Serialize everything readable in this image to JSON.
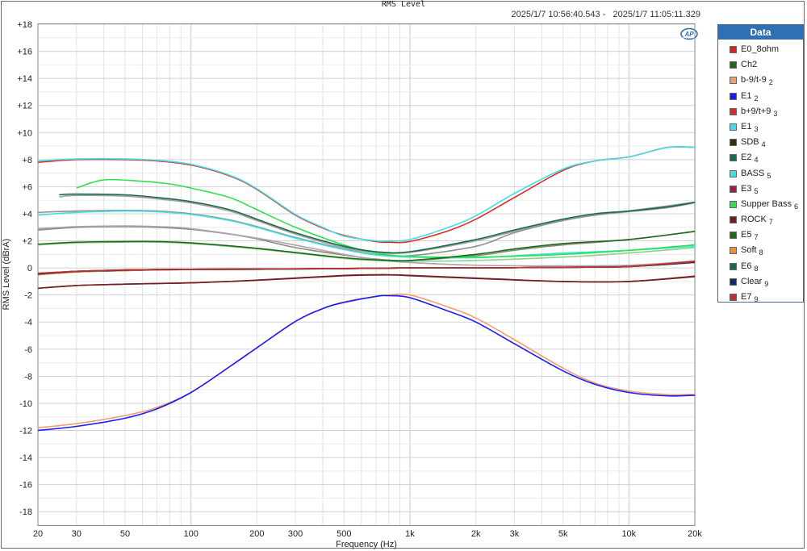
{
  "chart_data": {
    "type": "line",
    "title": "RMS Level",
    "timestamp": "2025/1/7 10:56:40.543 -   2025/1/7 11:05:11.329",
    "xlabel": "Frequency (Hz)",
    "ylabel": "RMS Level (dBrA)",
    "xscale": "log",
    "xlim": [
      20,
      20000
    ],
    "ylim": [
      -19,
      18
    ],
    "grid": true,
    "legend_position": "right",
    "legend_title": "Data",
    "x_ticks": [
      {
        "v": 20,
        "label": "20"
      },
      {
        "v": 30,
        "label": "30"
      },
      {
        "v": 50,
        "label": "50"
      },
      {
        "v": 100,
        "label": "100"
      },
      {
        "v": 200,
        "label": "200"
      },
      {
        "v": 300,
        "label": "300"
      },
      {
        "v": 500,
        "label": "500"
      },
      {
        "v": 1000,
        "label": "1k"
      },
      {
        "v": 2000,
        "label": "2k"
      },
      {
        "v": 3000,
        "label": "3k"
      },
      {
        "v": 5000,
        "label": "5k"
      },
      {
        "v": 10000,
        "label": "10k"
      },
      {
        "v": 20000,
        "label": "20k"
      }
    ],
    "y_ticks": [
      {
        "v": 18,
        "label": "+18"
      },
      {
        "v": 16,
        "label": "+16"
      },
      {
        "v": 14,
        "label": "+14"
      },
      {
        "v": 12,
        "label": "+12"
      },
      {
        "v": 10,
        "label": "+10"
      },
      {
        "v": 8,
        "label": "+8"
      },
      {
        "v": 6,
        "label": "+6"
      },
      {
        "v": 4,
        "label": "+4"
      },
      {
        "v": 2,
        "label": "+2"
      },
      {
        "v": 0,
        "label": "0"
      },
      {
        "v": -2,
        "label": "-2"
      },
      {
        "v": -4,
        "label": "-4"
      },
      {
        "v": -6,
        "label": "-6"
      },
      {
        "v": -8,
        "label": "-8"
      },
      {
        "v": -10,
        "label": "-10"
      },
      {
        "v": -12,
        "label": "-12"
      },
      {
        "v": -14,
        "label": "-14"
      },
      {
        "v": -16,
        "label": "-16"
      },
      {
        "v": -18,
        "label": "-18"
      }
    ],
    "series": [
      {
        "name": "E0_8ohm",
        "sub": "",
        "color": "#e02020",
        "x": [
          20,
          30,
          50,
          70,
          100,
          200,
          500,
          1000,
          2000,
          5000,
          10000,
          20000
        ],
        "y": [
          -0.4,
          -0.25,
          -0.15,
          -0.12,
          -0.1,
          -0.08,
          -0.05,
          0,
          0,
          0.05,
          0.1,
          0.5
        ]
      },
      {
        "name": "Ch2",
        "sub": "",
        "color": "#1a6a1a",
        "x": [
          20,
          30,
          50,
          70,
          100,
          200,
          500,
          1000,
          2000,
          5000,
          10000,
          20000
        ],
        "y": [
          -0.5,
          -0.3,
          -0.2,
          -0.15,
          -0.12,
          -0.1,
          -0.05,
          0,
          0,
          0.05,
          0.1,
          0.4
        ]
      },
      {
        "name": "b-9/t-9",
        "sub": "2",
        "color": "#f0a070",
        "x": [
          20,
          30,
          50,
          70,
          100,
          150,
          200,
          300,
          400,
          500,
          700,
          800,
          1000,
          1500,
          2000,
          3000,
          5000,
          7000,
          10000,
          15000,
          20000
        ],
        "y": [
          -11.8,
          -11.5,
          -10.9,
          -10.3,
          -9.2,
          -7.3,
          -5.9,
          -3.95,
          -3.0,
          -2.5,
          -2.1,
          -2.0,
          -2.0,
          -2.9,
          -3.7,
          -5.3,
          -7.4,
          -8.5,
          -9.1,
          -9.35,
          -9.35
        ]
      },
      {
        "name": "E1",
        "sub": "2",
        "color": "#1a1aff",
        "x": [
          20,
          30,
          50,
          70,
          100,
          150,
          200,
          300,
          400,
          500,
          700,
          800,
          1000,
          1500,
          2000,
          3000,
          5000,
          7000,
          10000,
          15000,
          20000
        ],
        "y": [
          -12.0,
          -11.7,
          -11.1,
          -10.4,
          -9.2,
          -7.3,
          -5.9,
          -3.95,
          -3.0,
          -2.55,
          -2.1,
          -2.05,
          -2.2,
          -3.2,
          -4.0,
          -5.6,
          -7.6,
          -8.6,
          -9.2,
          -9.45,
          -9.4
        ]
      },
      {
        "name": "b+9/t+9",
        "sub": "3",
        "color": "#e02828",
        "x": [
          20,
          30,
          50,
          70,
          100,
          150,
          200,
          300,
          400,
          500,
          700,
          800,
          1000,
          1500,
          2000,
          3000,
          5000,
          7000,
          10000,
          15000,
          20000
        ],
        "y": [
          7.8,
          8.0,
          8.0,
          7.9,
          7.6,
          6.8,
          5.8,
          3.9,
          2.95,
          2.4,
          1.95,
          1.9,
          1.95,
          2.75,
          3.6,
          5.2,
          7.2,
          7.9,
          8.2,
          8.9,
          8.9
        ]
      },
      {
        "name": "E1",
        "sub": "3",
        "color": "#40e0e8",
        "x": [
          20,
          30,
          50,
          70,
          100,
          150,
          200,
          300,
          400,
          500,
          700,
          800,
          1000,
          1500,
          2000,
          3000,
          5000,
          7000,
          10000,
          15000,
          20000
        ],
        "y": [
          7.9,
          8.05,
          8.05,
          7.95,
          7.65,
          6.85,
          5.85,
          3.95,
          3.0,
          2.35,
          2.0,
          2.0,
          2.1,
          3.0,
          3.85,
          5.5,
          7.3,
          7.9,
          8.2,
          8.9,
          8.9
        ]
      },
      {
        "name": "SDB",
        "sub": "4",
        "color": "#3a2a10",
        "x": [
          20,
          30,
          50,
          70,
          100,
          200,
          500,
          1000,
          2000,
          5000,
          10000,
          20000
        ],
        "y": [
          -0.45,
          -0.25,
          -0.15,
          -0.12,
          -0.1,
          -0.08,
          -0.04,
          0,
          0,
          0.05,
          0.1,
          0.45
        ]
      },
      {
        "name": "E2",
        "sub": "4",
        "color": "#1a6a50",
        "x": [
          20,
          30,
          50,
          70,
          100,
          200,
          500,
          1000,
          2000,
          5000,
          10000,
          20000
        ],
        "y": [
          -0.45,
          -0.28,
          -0.18,
          -0.14,
          -0.12,
          -0.1,
          -0.05,
          0,
          0,
          0.05,
          0.1,
          0.45
        ]
      },
      {
        "name": "BASS",
        "sub": "5",
        "color": "#40e0e8",
        "x": [
          20,
          30,
          50,
          70,
          100,
          150,
          200,
          300,
          500,
          700,
          1000,
          2000,
          3000,
          5000,
          10000,
          20000
        ],
        "y": [
          3.9,
          4.1,
          4.2,
          4.15,
          3.95,
          3.5,
          3.0,
          2.2,
          1.35,
          0.95,
          0.8,
          0.75,
          0.9,
          1.1,
          1.3,
          1.6
        ]
      },
      {
        "name": "E3",
        "sub": "5",
        "color": "#a02040",
        "x": [
          20,
          30,
          50,
          70,
          100,
          200,
          500,
          800,
          1000,
          2000,
          5000,
          10000,
          20000
        ],
        "y": [
          -1.5,
          -1.3,
          -1.2,
          -1.15,
          -1.1,
          -0.9,
          -0.55,
          -0.5,
          -0.55,
          -0.75,
          -1.0,
          -1.0,
          -0.6
        ]
      },
      {
        "name": "Supper Bass",
        "sub": "6",
        "color": "#30e050",
        "x": [
          30,
          40,
          60,
          80,
          100,
          150,
          200,
          300,
          500,
          700,
          1000,
          2000,
          5000,
          10000,
          20000
        ],
        "y": [
          5.9,
          6.5,
          6.4,
          6.2,
          5.9,
          5.2,
          4.3,
          3.0,
          1.7,
          1.1,
          0.85,
          0.8,
          1.0,
          1.3,
          1.7
        ]
      },
      {
        "name": "ROCK",
        "sub": "7",
        "color": "#702020",
        "x": [
          20,
          30,
          50,
          70,
          100,
          200,
          500,
          800,
          1000,
          2000,
          5000,
          10000,
          20000
        ],
        "y": [
          -1.5,
          -1.3,
          -1.2,
          -1.15,
          -1.1,
          -0.92,
          -0.58,
          -0.52,
          -0.58,
          -0.78,
          -1.0,
          -1.0,
          -0.65
        ]
      },
      {
        "name": "E5",
        "sub": "7",
        "color": "#1a6a1a",
        "x": [
          20,
          30,
          50,
          70,
          100,
          200,
          500,
          800,
          1000,
          2000,
          3000,
          5000,
          10000,
          20000
        ],
        "y": [
          1.75,
          1.9,
          1.95,
          1.95,
          1.85,
          1.45,
          0.75,
          0.55,
          0.55,
          1.0,
          1.4,
          1.8,
          2.1,
          2.7
        ]
      },
      {
        "name": "Soft",
        "sub": "8",
        "color": "#f09030",
        "x": [
          20,
          30,
          50,
          70,
          100,
          200,
          500,
          1000,
          2000,
          5000,
          10000,
          20000
        ],
        "y": [
          -0.5,
          -0.3,
          -0.2,
          -0.15,
          -0.12,
          -0.1,
          -0.05,
          0,
          0,
          0.05,
          0.1,
          0.4
        ]
      },
      {
        "name": "E6",
        "sub": "8",
        "color": "#1a6a4a",
        "x": [
          25,
          30,
          50,
          70,
          100,
          150,
          200,
          300,
          500,
          700,
          1000,
          2000,
          3000,
          5000,
          7000,
          10000,
          15000,
          20000
        ],
        "y": [
          5.4,
          5.45,
          5.4,
          5.2,
          4.9,
          4.3,
          3.6,
          2.6,
          1.6,
          1.2,
          1.2,
          2.1,
          2.8,
          3.6,
          4.0,
          4.2,
          4.5,
          4.85
        ]
      },
      {
        "name": "Clear",
        "sub": "9",
        "color": "#102a70",
        "x": [
          20,
          30,
          50,
          70,
          100,
          200,
          500,
          1000,
          2000,
          5000,
          10000,
          20000
        ],
        "y": [
          -0.45,
          -0.27,
          -0.17,
          -0.13,
          -0.11,
          -0.09,
          -0.05,
          0,
          0,
          0.05,
          0.1,
          0.42
        ]
      },
      {
        "name": "E7",
        "sub": "9",
        "color": "#c03030",
        "x": [
          20,
          30,
          50,
          70,
          100,
          200,
          500,
          1000,
          2000,
          5000,
          10000,
          20000
        ],
        "y": [
          -0.4,
          -0.25,
          -0.15,
          -0.12,
          -0.1,
          -0.08,
          -0.04,
          0,
          0,
          0.05,
          0.1,
          0.48
        ]
      }
    ],
    "extra_curves": [
      {
        "color": "#a0a0a0",
        "x": [
          25,
          30,
          50,
          70,
          100,
          150,
          200,
          300,
          500,
          700,
          1000,
          2000,
          3000,
          5000,
          7000,
          10000,
          15000,
          20000
        ],
        "y": [
          5.25,
          5.35,
          5.3,
          5.1,
          4.8,
          4.2,
          3.5,
          2.5,
          1.5,
          1.15,
          1.15,
          2.0,
          2.7,
          3.5,
          3.9,
          4.15,
          4.45,
          4.8
        ]
      },
      {
        "color": "#909090",
        "x": [
          20,
          30,
          50,
          70,
          100,
          150,
          200,
          300,
          500,
          700,
          1000,
          2000,
          3000,
          5000,
          7000,
          10000,
          20000
        ],
        "y": [
          4.1,
          4.2,
          4.25,
          4.2,
          4.0,
          3.55,
          3.05,
          2.25,
          1.4,
          1.0,
          0.9,
          1.6,
          2.6,
          3.5,
          3.9,
          4.2,
          4.85
        ]
      },
      {
        "color": "#8a8a7a",
        "x": [
          20,
          30,
          50,
          70,
          100,
          150,
          200,
          300,
          500,
          700,
          1000,
          2000,
          3000,
          5000,
          10000,
          20000
        ],
        "y": [
          2.8,
          3.0,
          3.05,
          3.0,
          2.85,
          2.5,
          2.15,
          1.5,
          0.95,
          0.65,
          0.55,
          0.9,
          1.3,
          1.7,
          2.1,
          2.7
        ]
      },
      {
        "color": "#b0a0b0",
        "x": [
          20,
          30,
          50,
          70,
          100,
          200,
          500,
          700,
          1000,
          2000,
          5000,
          10000,
          20000
        ],
        "y": [
          2.9,
          3.05,
          3.1,
          3.05,
          2.9,
          2.2,
          1.0,
          0.6,
          0.4,
          0.2,
          0.15,
          0.2,
          0.5
        ]
      },
      {
        "color": "#90d090",
        "x": [
          20,
          30,
          50,
          70,
          100,
          200,
          500,
          700,
          1000,
          2000,
          5000,
          10000,
          20000
        ],
        "y": [
          1.7,
          1.85,
          1.9,
          1.9,
          1.8,
          1.4,
          0.7,
          0.55,
          0.5,
          0.55,
          0.8,
          1.1,
          1.5
        ]
      }
    ]
  }
}
